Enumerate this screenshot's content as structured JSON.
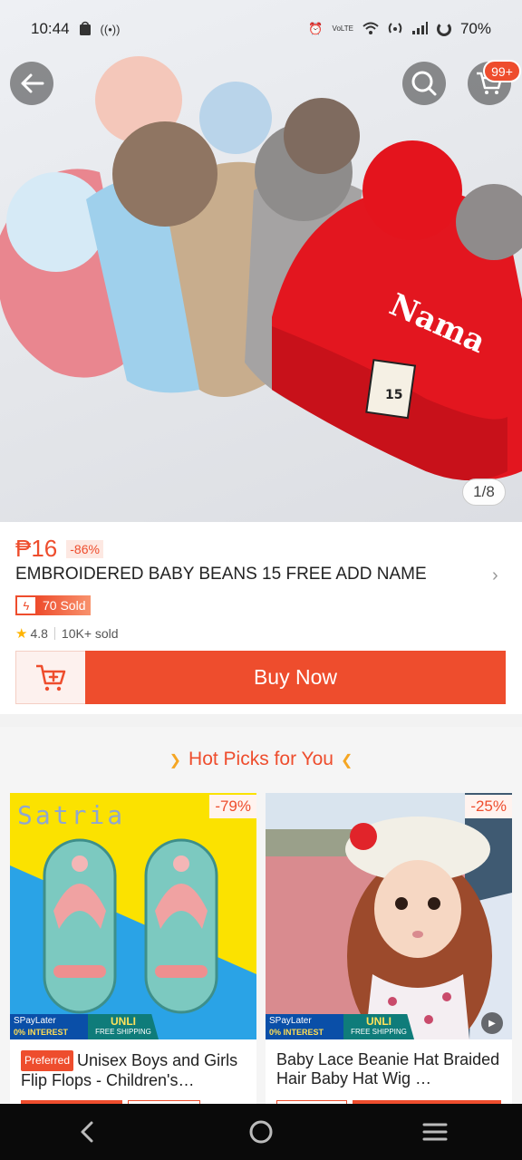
{
  "status_bar": {
    "time": "10:44",
    "battery": "70%",
    "left_icons": [
      "shopee-bag-icon",
      "radio-waves-icon"
    ],
    "right_icons": [
      "alarm-icon",
      "volte-icon",
      "wifi-icon",
      "hotspot-icon",
      "signal-icon",
      "battery-icon"
    ],
    "volte_label": "VoLTE"
  },
  "header": {
    "back_icon": "back-arrow-icon",
    "search_icon": "search-icon",
    "cart_icon": "cart-icon",
    "cart_badge": "99+"
  },
  "gallery": {
    "counter": "1/8",
    "hat_text": "Nama",
    "tag_text": "15"
  },
  "product": {
    "price": "₱16",
    "discount": "-86%",
    "title": "EMBROIDERED BABY BEANS 15 FREE ADD NAME",
    "sold_badge": "70 Sold",
    "rating": "4.8",
    "total_sold": "10K+ sold",
    "buy_now_label": "Buy Now"
  },
  "hot_picks": {
    "title": "Hot Picks for You",
    "items": [
      {
        "brand_text": "Satria",
        "discount": "-79%",
        "tag": "Preferred",
        "name": "Unisex Boys and Girls Flip Flops - Children's…",
        "promo_spay": "SPayLater",
        "promo_interest": "0% INTEREST",
        "promo_unli": "UNLI",
        "promo_shipping": "FREE SHIPPING"
      },
      {
        "discount": "-25%",
        "name": "Baby Lace Beanie Hat Braided Hair Baby Hat Wig …",
        "promo_spay": "SPayLater",
        "promo_interest": "0% INTEREST",
        "promo_unli": "UNLI",
        "promo_shipping": "FREE SHIPPING"
      }
    ]
  },
  "nav_bar": {
    "buttons": [
      "back-nav-icon",
      "home-nav-icon",
      "recents-nav-icon"
    ]
  },
  "colors": {
    "accent": "#ee4d2d",
    "star": "#ffb400"
  }
}
